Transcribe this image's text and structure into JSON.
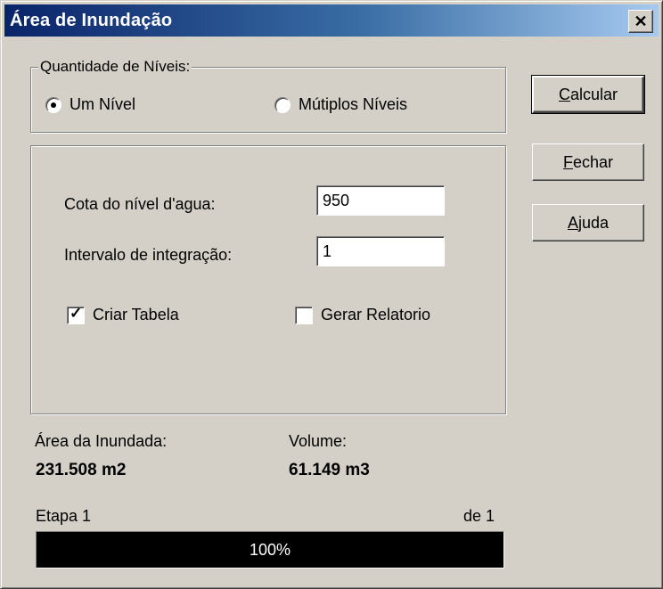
{
  "window": {
    "title": "Área de Inundação",
    "close_glyph": "✕"
  },
  "levels_group": {
    "legend": "Quantidade de Níveis:",
    "options": [
      {
        "label": "Um Nível",
        "selected": true
      },
      {
        "label": "Mútiplos Níveis",
        "selected": false
      }
    ]
  },
  "params": {
    "water_level_label": "Cota do nível d'agua:",
    "water_level_value": "950",
    "interval_label": "Intervalo de integração:",
    "interval_value": "1",
    "create_table_label": "Criar Tabela",
    "create_table_checked": true,
    "report_label": "Gerar Relatorio",
    "report_checked": false
  },
  "results": {
    "area_label": "Área da Inundada:",
    "area_value": "231.508 m2",
    "volume_label": "Volume:",
    "volume_value": "61.149 m3"
  },
  "progress": {
    "step_label": "Etapa 1",
    "of_label": "de 1",
    "percent_text": "100%",
    "fraction": 1.0
  },
  "buttons": {
    "calcular": {
      "mnemonic": "C",
      "rest": "alcular"
    },
    "fechar": {
      "mnemonic": "F",
      "rest": "echar"
    },
    "ajuda": {
      "mnemonic": "A",
      "rest": "juda"
    }
  },
  "icons": {
    "close": "close-icon",
    "radio_dot": "radio-dot-icon",
    "check": "checkmark-icon"
  }
}
